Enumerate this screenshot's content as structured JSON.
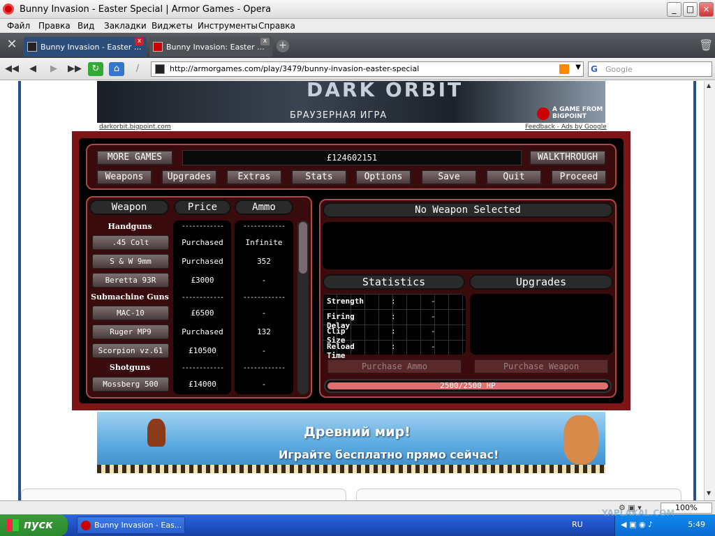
{
  "window": {
    "title": "Bunny Invasion - Easter Special | Armor Games - Opera",
    "min": "_",
    "max": "□",
    "close": "×"
  },
  "menu": [
    "Файл",
    "Правка",
    "Вид",
    "Закладки",
    "Виджеты",
    "Инструменты",
    "Справка"
  ],
  "tabs": [
    {
      "label": "Bunny Invasion - Easter ..."
    },
    {
      "label": "Bunny Invasion: Easter ..."
    }
  ],
  "address": {
    "url": "http://armorgames.com/play/3479/bunny-invasion-easter-special",
    "search_placeholder": "Google"
  },
  "nav_icons": [
    "rewind-icon",
    "back-icon",
    "forward-icon",
    "fast-forward-icon",
    "reload-icon",
    "home-icon",
    "wand-icon"
  ],
  "top_ad": {
    "logo": "DARK ORBIT",
    "subtitle": "БРАУЗЕРНАЯ ИГРА",
    "brand": "A GAME FROM BIGPOINT",
    "link_left": "darkorbit.bigpoint.com",
    "link_right": "Feedback - Ads by Google"
  },
  "game": {
    "more_games": "MORE GAMES",
    "money": "£124602151",
    "walkthrough": "WALKTHROUGH",
    "nav": [
      "Weapons",
      "Upgrades",
      "Extras",
      "Stats",
      "Options",
      "Save",
      "Quit",
      "Proceed"
    ],
    "headers": {
      "weapon": "Weapon",
      "price": "Price",
      "ammo": "Ammo"
    },
    "categories": [
      "Handguns",
      "Submachine Guns",
      "Shotguns"
    ],
    "dashes": "------------",
    "weapons": [
      {
        "name": ".45 Colt",
        "price": "Purchased",
        "ammo": "Infinite"
      },
      {
        "name": "S & W 9mm",
        "price": "Purchased",
        "ammo": "352"
      },
      {
        "name": "Beretta 93R",
        "price": "£3000",
        "ammo": "-"
      },
      {
        "name": "MAC-10",
        "price": "£6500",
        "ammo": "-"
      },
      {
        "name": "Ruger MP9",
        "price": "Purchased",
        "ammo": "132"
      },
      {
        "name": "Scorpion vz.61",
        "price": "£10500",
        "ammo": "-"
      },
      {
        "name": "Mossberg 500",
        "price": "£14000",
        "ammo": "-"
      }
    ],
    "selected": "No Weapon Selected",
    "statistics_label": "Statistics",
    "upgrades_label": "Upgrades",
    "stats": [
      {
        "label": "Strength",
        "sep": ":",
        "value": "-"
      },
      {
        "label": "Firing Delay",
        "sep": ":",
        "value": "-"
      },
      {
        "label": "Clip Size",
        "sep": ":",
        "value": "-"
      },
      {
        "label": "Reload Time",
        "sep": ":",
        "value": "-"
      }
    ],
    "purchase_ammo": "Purchase Ammo",
    "purchase_weapon": "Purchase Weapon",
    "hp": "2500/2500 HP",
    "hp_fraction": 1.0,
    "colors": {
      "panel": "#7d1415",
      "accent": "#a94a4a",
      "hp_bar": "#e07070"
    }
  },
  "bottom_ad": {
    "line1": "Древний мир!",
    "line2": "Играйте бесплатно прямо сейчас!"
  },
  "status": {
    "zoom": "100%"
  },
  "taskbar": {
    "start": "пуск",
    "task": "Bunny Invasion - Eas...",
    "lang": "RU",
    "clock": "5:49"
  },
  "watermark": "YAPLAKAL.COM"
}
